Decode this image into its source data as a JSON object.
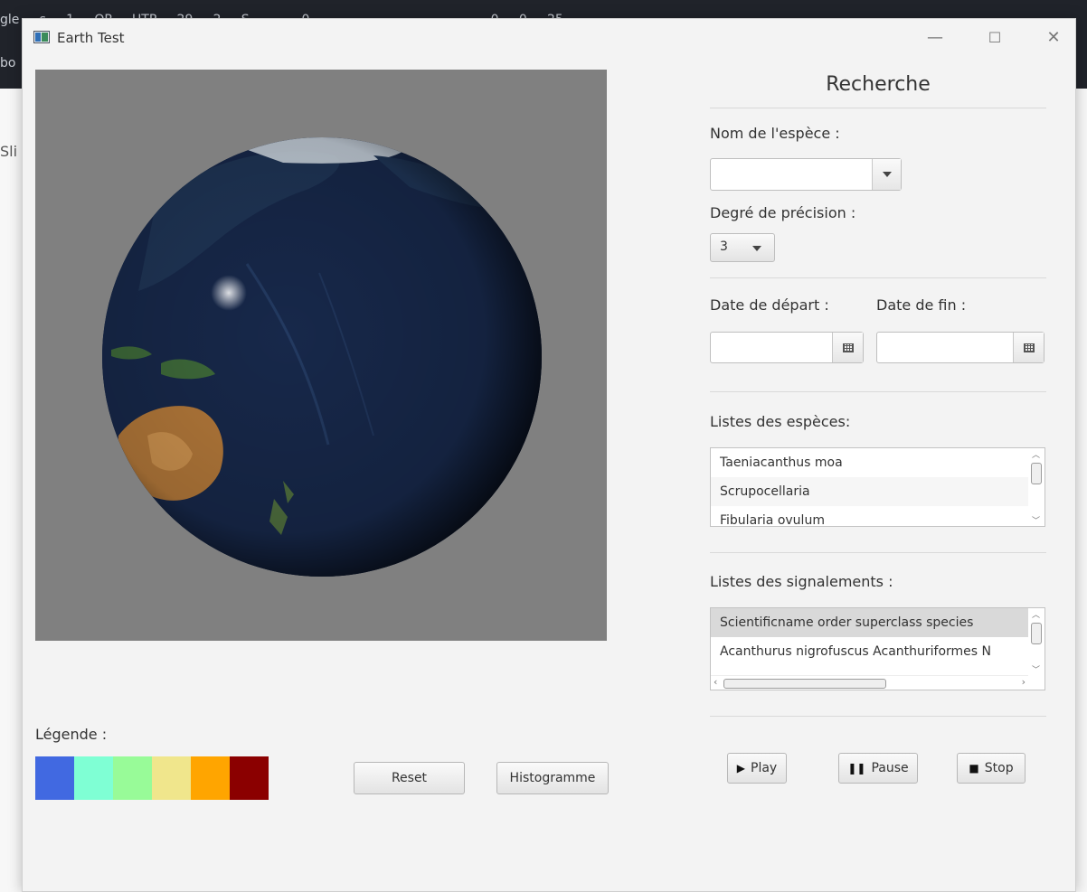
{
  "background": {
    "top_text": "gle ... s ... 1 ... OP ... UTP ... 29 ... 2 ... S ... ... ... 0 ... ... ... ... ... ... ... ... ... ... ... 0 ... 0 ... 25",
    "frag_left1": "bo",
    "frag_left2": "Sli",
    "frag_left3": "g"
  },
  "window": {
    "title": "Earth Test",
    "controls": {
      "minimize": "—",
      "maximize": "☐",
      "close": "✕"
    }
  },
  "legend": {
    "title": "Légende :",
    "colors": [
      "#4169e1",
      "#7fffd4",
      "#98fb98",
      "#f0e68c",
      "#ffa500",
      "#8b0000"
    ]
  },
  "buttons": {
    "reset": "Reset",
    "histogram": "Histogramme"
  },
  "search_panel": {
    "title": "Recherche",
    "species_label": "Nom de l'espèce :",
    "species_value": "",
    "precision_label": "Degré de précision :",
    "precision_value": "3",
    "start_date_label": "Date de départ :",
    "end_date_label": "Date de fin :",
    "start_date_value": "",
    "end_date_value": "",
    "species_list_label": "Listes des espèces:",
    "species_list": [
      "Taeniacanthus moa",
      "Scrupocellaria",
      "Fibularia ovulum"
    ],
    "reports_label": "Listes des signalements :",
    "reports_header": "Scientificname  order  superclass  species",
    "reports_rows": [
      "Acanthurus nigrofuscus  Acanthuriformes  N"
    ]
  },
  "playback": {
    "play": "Play",
    "pause": "Pause",
    "stop": "Stop"
  }
}
